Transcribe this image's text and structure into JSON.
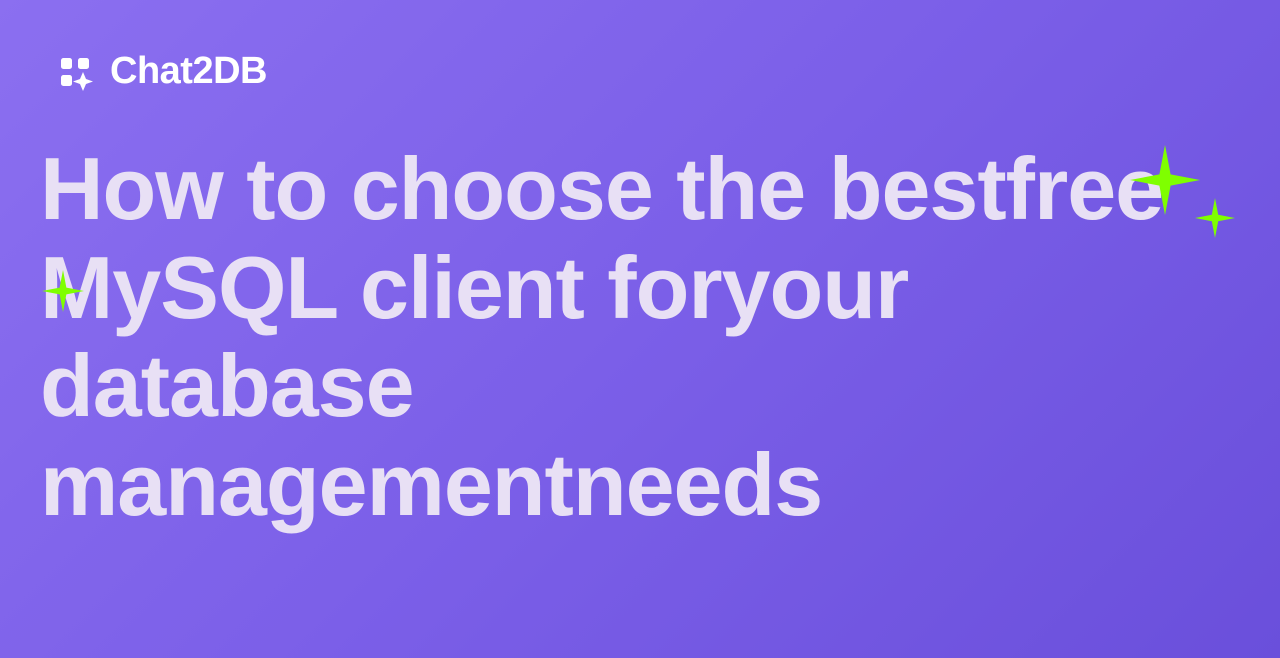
{
  "logo": {
    "brand_name": "Chat2DB"
  },
  "title": "How to choose the bestfree MySQL client foryour database managementneeds",
  "colors": {
    "background_start": "#8b6ff0",
    "background_end": "#6a4fdb",
    "text_primary": "#e8e0f5",
    "accent_star": "#7fff00",
    "logo_text": "#ffffff"
  }
}
